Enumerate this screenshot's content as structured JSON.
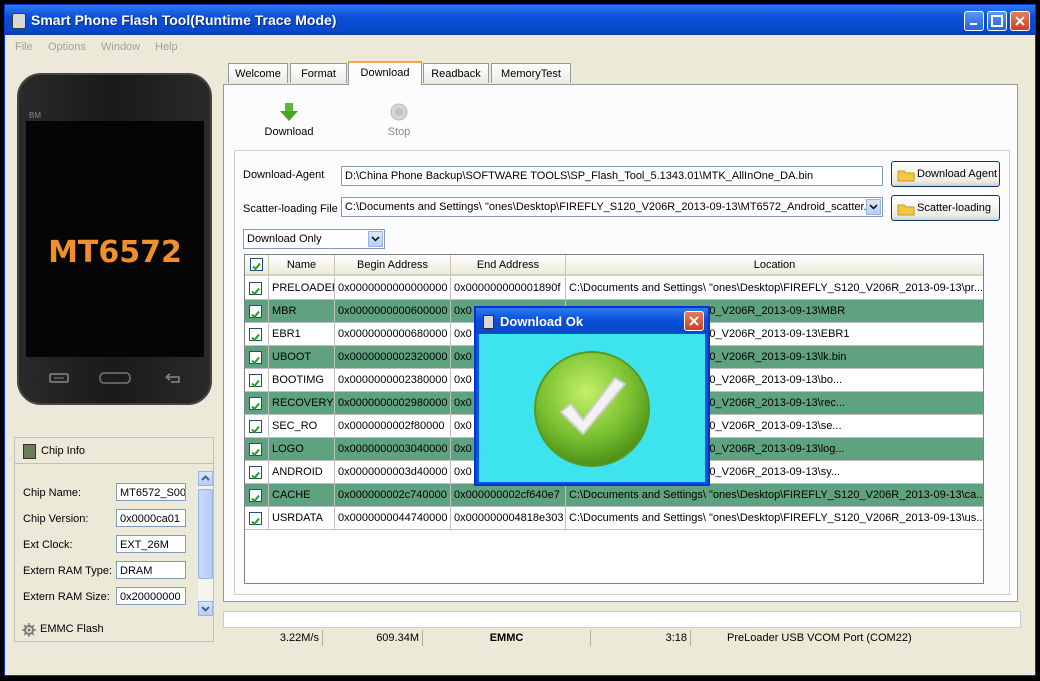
{
  "window": {
    "title": "Smart Phone Flash Tool(Runtime Trace Mode)"
  },
  "menu": [
    "File",
    "Options",
    "Window",
    "Help"
  ],
  "phone": {
    "brand": "BM",
    "chip": "MT6572"
  },
  "chip_info": {
    "title": "Chip Info",
    "rows": [
      {
        "label": "Chip Name:",
        "value": "MT6572_S00"
      },
      {
        "label": "Chip Version:",
        "value": "0x0000ca01"
      },
      {
        "label": "Ext Clock:",
        "value": "EXT_26M"
      },
      {
        "label": "Extern RAM Type:",
        "value": "DRAM"
      },
      {
        "label": "Extern RAM Size:",
        "value": "0x20000000"
      }
    ],
    "emmc_label": "EMMC Flash"
  },
  "tabs": [
    {
      "label": "Welcome"
    },
    {
      "label": "Format"
    },
    {
      "label": "Download",
      "active": true
    },
    {
      "label": "Readback"
    },
    {
      "label": "MemoryTest"
    }
  ],
  "toolbar": {
    "download_label": "Download",
    "stop_label": "Stop"
  },
  "form": {
    "da_label": "Download-Agent",
    "da_path": "D:\\China Phone Backup\\SOFTWARE TOOLS\\SP_Flash_Tool_5.1343.01\\MTK_AllInOne_DA.bin",
    "da_button": "Download Agent",
    "scatter_label": "Scatter-loading File",
    "scatter_path": "C:\\Documents and Settings\\ \"ones\\Desktop\\FIREFLY_S120_V206R_2013-09-13\\MT6572_Android_scatter.txt",
    "scatter_button": "Scatter-loading",
    "mode_selected": "Download Only"
  },
  "table": {
    "headers": [
      "Name",
      "Begin Address",
      "End Address",
      "Location"
    ],
    "rows": [
      {
        "name": "PRELOADER",
        "begin": "0x0000000000000000",
        "end": "0x000000000001890f",
        "location": "C:\\Documents and Settings\\ \"ones\\Desktop\\FIREFLY_S120_V206R_2013-09-13\\pr..."
      },
      {
        "name": "MBR",
        "begin": "0x0000000000600000",
        "end": "0x0",
        "location": "ones\\Desktop\\FIREFLY_S120_V206R_2013-09-13\\MBR"
      },
      {
        "name": "EBR1",
        "begin": "0x0000000000680000",
        "end": "0x0",
        "location": "ones\\Desktop\\FIREFLY_S120_V206R_2013-09-13\\EBR1"
      },
      {
        "name": "UBOOT",
        "begin": "0x0000000002320000",
        "end": "0x0",
        "location": "ones\\Desktop\\FIREFLY_S120_V206R_2013-09-13\\lk.bin"
      },
      {
        "name": "BOOTIMG",
        "begin": "0x0000000002380000",
        "end": "0x0",
        "location": "ones\\Desktop\\FIREFLY_S120_V206R_2013-09-13\\bo..."
      },
      {
        "name": "RECOVERY",
        "begin": "0x0000000002980000",
        "end": "0x0",
        "location": "ones\\Desktop\\FIREFLY_S120_V206R_2013-09-13\\rec..."
      },
      {
        "name": "SEC_RO",
        "begin": "0x0000000002f80000",
        "end": "0x0",
        "location": "ones\\Desktop\\FIREFLY_S120_V206R_2013-09-13\\se..."
      },
      {
        "name": "LOGO",
        "begin": "0x0000000003040000",
        "end": "0x0",
        "location": "ones\\Desktop\\FIREFLY_S120_V206R_2013-09-13\\log..."
      },
      {
        "name": "ANDROID",
        "begin": "0x0000000003d40000",
        "end": "0x0",
        "location": "ones\\Desktop\\FIREFLY_S120_V206R_2013-09-13\\sy..."
      },
      {
        "name": "CACHE",
        "begin": "0x000000002c740000",
        "end": "0x000000002cf640e7",
        "location": "C:\\Documents and Settings\\ \"ones\\Desktop\\FIREFLY_S120_V206R_2013-09-13\\ca..."
      },
      {
        "name": "USRDATA",
        "begin": "0x0000000044740000",
        "end": "0x000000004818e303",
        "location": "C:\\Documents and Settings\\ \"ones\\Desktop\\FIREFLY_S120_V206R_2013-09-13\\us..."
      }
    ]
  },
  "status": {
    "speed": "3.22M/s",
    "size": "609.34M",
    "storage": "EMMC",
    "time": "3:18",
    "port": "PreLoader USB VCOM Port (COM22)"
  },
  "dialog": {
    "title": "Download Ok"
  },
  "colors": {
    "row_green": "#5ea27f",
    "dialog_body": "#3de4ee",
    "xp_blue": "#0a4fd8",
    "check_green": "#7cc233"
  }
}
